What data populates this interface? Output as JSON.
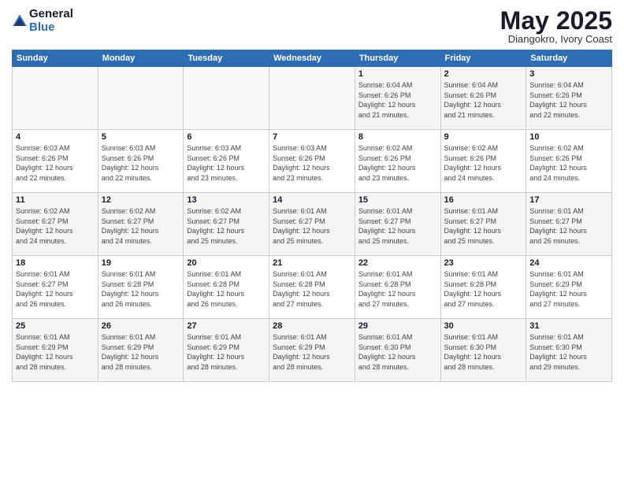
{
  "logo": {
    "general": "General",
    "blue": "Blue"
  },
  "header": {
    "title": "May 2025",
    "location": "Diangokro, Ivory Coast"
  },
  "weekdays": [
    "Sunday",
    "Monday",
    "Tuesday",
    "Wednesday",
    "Thursday",
    "Friday",
    "Saturday"
  ],
  "weeks": [
    [
      {
        "day": "",
        "info": ""
      },
      {
        "day": "",
        "info": ""
      },
      {
        "day": "",
        "info": ""
      },
      {
        "day": "",
        "info": ""
      },
      {
        "day": "1",
        "info": "Sunrise: 6:04 AM\nSunset: 6:26 PM\nDaylight: 12 hours\nand 21 minutes."
      },
      {
        "day": "2",
        "info": "Sunrise: 6:04 AM\nSunset: 6:26 PM\nDaylight: 12 hours\nand 21 minutes."
      },
      {
        "day": "3",
        "info": "Sunrise: 6:04 AM\nSunset: 6:26 PM\nDaylight: 12 hours\nand 22 minutes."
      }
    ],
    [
      {
        "day": "4",
        "info": "Sunrise: 6:03 AM\nSunset: 6:26 PM\nDaylight: 12 hours\nand 22 minutes."
      },
      {
        "day": "5",
        "info": "Sunrise: 6:03 AM\nSunset: 6:26 PM\nDaylight: 12 hours\nand 22 minutes."
      },
      {
        "day": "6",
        "info": "Sunrise: 6:03 AM\nSunset: 6:26 PM\nDaylight: 12 hours\nand 23 minutes."
      },
      {
        "day": "7",
        "info": "Sunrise: 6:03 AM\nSunset: 6:26 PM\nDaylight: 12 hours\nand 23 minutes."
      },
      {
        "day": "8",
        "info": "Sunrise: 6:02 AM\nSunset: 6:26 PM\nDaylight: 12 hours\nand 23 minutes."
      },
      {
        "day": "9",
        "info": "Sunrise: 6:02 AM\nSunset: 6:26 PM\nDaylight: 12 hours\nand 24 minutes."
      },
      {
        "day": "10",
        "info": "Sunrise: 6:02 AM\nSunset: 6:26 PM\nDaylight: 12 hours\nand 24 minutes."
      }
    ],
    [
      {
        "day": "11",
        "info": "Sunrise: 6:02 AM\nSunset: 6:27 PM\nDaylight: 12 hours\nand 24 minutes."
      },
      {
        "day": "12",
        "info": "Sunrise: 6:02 AM\nSunset: 6:27 PM\nDaylight: 12 hours\nand 24 minutes."
      },
      {
        "day": "13",
        "info": "Sunrise: 6:02 AM\nSunset: 6:27 PM\nDaylight: 12 hours\nand 25 minutes."
      },
      {
        "day": "14",
        "info": "Sunrise: 6:01 AM\nSunset: 6:27 PM\nDaylight: 12 hours\nand 25 minutes."
      },
      {
        "day": "15",
        "info": "Sunrise: 6:01 AM\nSunset: 6:27 PM\nDaylight: 12 hours\nand 25 minutes."
      },
      {
        "day": "16",
        "info": "Sunrise: 6:01 AM\nSunset: 6:27 PM\nDaylight: 12 hours\nand 25 minutes."
      },
      {
        "day": "17",
        "info": "Sunrise: 6:01 AM\nSunset: 6:27 PM\nDaylight: 12 hours\nand 26 minutes."
      }
    ],
    [
      {
        "day": "18",
        "info": "Sunrise: 6:01 AM\nSunset: 6:27 PM\nDaylight: 12 hours\nand 26 minutes."
      },
      {
        "day": "19",
        "info": "Sunrise: 6:01 AM\nSunset: 6:28 PM\nDaylight: 12 hours\nand 26 minutes."
      },
      {
        "day": "20",
        "info": "Sunrise: 6:01 AM\nSunset: 6:28 PM\nDaylight: 12 hours\nand 26 minutes."
      },
      {
        "day": "21",
        "info": "Sunrise: 6:01 AM\nSunset: 6:28 PM\nDaylight: 12 hours\nand 27 minutes."
      },
      {
        "day": "22",
        "info": "Sunrise: 6:01 AM\nSunset: 6:28 PM\nDaylight: 12 hours\nand 27 minutes."
      },
      {
        "day": "23",
        "info": "Sunrise: 6:01 AM\nSunset: 6:28 PM\nDaylight: 12 hours\nand 27 minutes."
      },
      {
        "day": "24",
        "info": "Sunrise: 6:01 AM\nSunset: 6:29 PM\nDaylight: 12 hours\nand 27 minutes."
      }
    ],
    [
      {
        "day": "25",
        "info": "Sunrise: 6:01 AM\nSunset: 6:29 PM\nDaylight: 12 hours\nand 28 minutes."
      },
      {
        "day": "26",
        "info": "Sunrise: 6:01 AM\nSunset: 6:29 PM\nDaylight: 12 hours\nand 28 minutes."
      },
      {
        "day": "27",
        "info": "Sunrise: 6:01 AM\nSunset: 6:29 PM\nDaylight: 12 hours\nand 28 minutes."
      },
      {
        "day": "28",
        "info": "Sunrise: 6:01 AM\nSunset: 6:29 PM\nDaylight: 12 hours\nand 28 minutes."
      },
      {
        "day": "29",
        "info": "Sunrise: 6:01 AM\nSunset: 6:30 PM\nDaylight: 12 hours\nand 28 minutes."
      },
      {
        "day": "30",
        "info": "Sunrise: 6:01 AM\nSunset: 6:30 PM\nDaylight: 12 hours\nand 28 minutes."
      },
      {
        "day": "31",
        "info": "Sunrise: 6:01 AM\nSunset: 6:30 PM\nDaylight: 12 hours\nand 29 minutes."
      }
    ]
  ]
}
